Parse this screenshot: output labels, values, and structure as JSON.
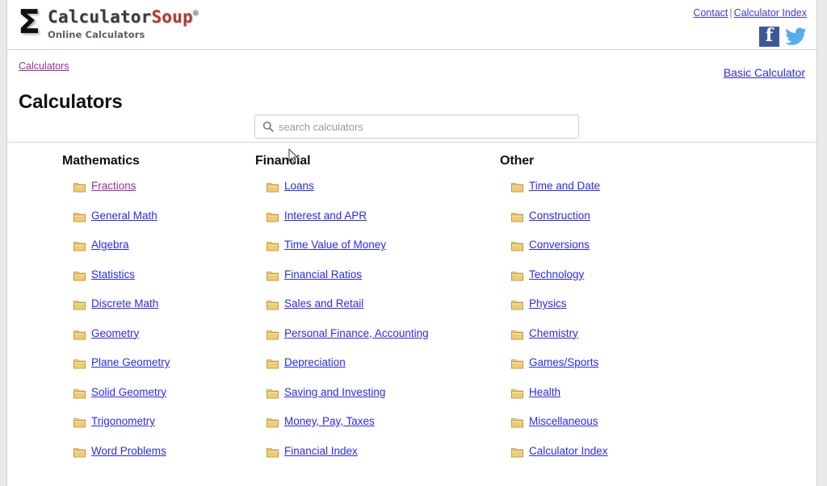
{
  "header": {
    "logo_symbol": "Σ",
    "brand_name_part1": "Calculator",
    "brand_name_part2": "Soup",
    "brand_registered": "®",
    "brand_subtitle": "Online Calculators",
    "top_links": [
      {
        "label": "Contact"
      },
      {
        "label": "Calculator Index"
      }
    ],
    "separator": "|",
    "social": [
      {
        "name": "facebook",
        "glyph": "f"
      },
      {
        "name": "twitter",
        "glyph": ""
      }
    ]
  },
  "breadcrumb": {
    "items": [
      {
        "label": "Calculators"
      }
    ]
  },
  "page_title": "Calculators",
  "basic_calculator_link": "Basic Calculator",
  "search": {
    "placeholder": "search calculators",
    "value": "",
    "icon": "search-icon"
  },
  "columns": [
    {
      "heading": "Mathematics",
      "items": [
        {
          "label": "Fractions",
          "visited": true
        },
        {
          "label": "General Math",
          "visited": false
        },
        {
          "label": "Algebra",
          "visited": false
        },
        {
          "label": "Statistics",
          "visited": false
        },
        {
          "label": "Discrete Math",
          "visited": false
        },
        {
          "label": "Geometry",
          "visited": false
        },
        {
          "label": "Plane Geometry",
          "visited": false
        },
        {
          "label": "Solid Geometry",
          "visited": false
        },
        {
          "label": "Trigonometry",
          "visited": false
        },
        {
          "label": "Word Problems",
          "visited": false
        }
      ]
    },
    {
      "heading": "Financial",
      "items": [
        {
          "label": "Loans",
          "visited": false
        },
        {
          "label": "Interest and APR",
          "visited": false
        },
        {
          "label": "Time Value of Money",
          "visited": false
        },
        {
          "label": "Financial Ratios",
          "visited": false
        },
        {
          "label": "Sales and Retail",
          "visited": false
        },
        {
          "label": "Personal Finance, Accounting",
          "visited": false
        },
        {
          "label": "Depreciation",
          "visited": false
        },
        {
          "label": "Saving and Investing",
          "visited": false
        },
        {
          "label": "Money, Pay, Taxes",
          "visited": false
        },
        {
          "label": "Financial Index",
          "visited": false
        }
      ]
    },
    {
      "heading": "Other",
      "items": [
        {
          "label": "Time and Date",
          "visited": false
        },
        {
          "label": "Construction",
          "visited": false
        },
        {
          "label": "Conversions",
          "visited": false
        },
        {
          "label": "Technology",
          "visited": false
        },
        {
          "label": "Physics",
          "visited": false
        },
        {
          "label": "Chemistry",
          "visited": false
        },
        {
          "label": "Games/Sports",
          "visited": false
        },
        {
          "label": "Health",
          "visited": false
        },
        {
          "label": "Miscellaneous",
          "visited": false
        },
        {
          "label": "Calculator Index",
          "visited": false
        }
      ]
    }
  ],
  "colors": {
    "link": "#2a2af0",
    "visited_link": "#9b2d9b",
    "brand_accent": "#b13a32",
    "facebook": "#3b5998",
    "twitter": "#55acee",
    "folder": "#e8c667",
    "separator": "#8a8a20"
  }
}
